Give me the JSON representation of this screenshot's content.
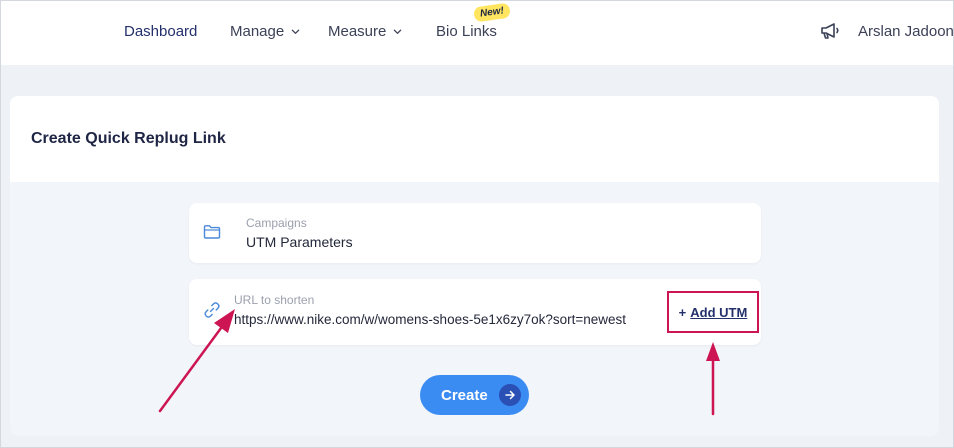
{
  "nav": {
    "items": [
      {
        "label": "Dashboard",
        "active": true
      },
      {
        "label": "Manage"
      },
      {
        "label": "Measure"
      },
      {
        "label": "Bio Links"
      }
    ],
    "new_badge": "New!",
    "user_name": "Arslan Jadoon",
    "icons": [
      "chevron-down-icon",
      "megaphone-icon"
    ]
  },
  "card": {
    "title": "Create Quick Replug Link",
    "campaign": {
      "label": "Campaigns",
      "value": "UTM Parameters",
      "icon": "folder-icon"
    },
    "url": {
      "label": "URL to shorten",
      "value": "https://www.nike.com/w/womens-shoes-5e1x6zy7ok?sort=newest",
      "icon": "link-icon"
    },
    "add_utm": {
      "prefix": "+",
      "label": "Add UTM"
    },
    "create_button": "Create"
  },
  "colors": {
    "accent": "#3b8cf2",
    "nav_active": "#23306b",
    "annotation": "#cc1552",
    "badge": "#ffe560"
  }
}
